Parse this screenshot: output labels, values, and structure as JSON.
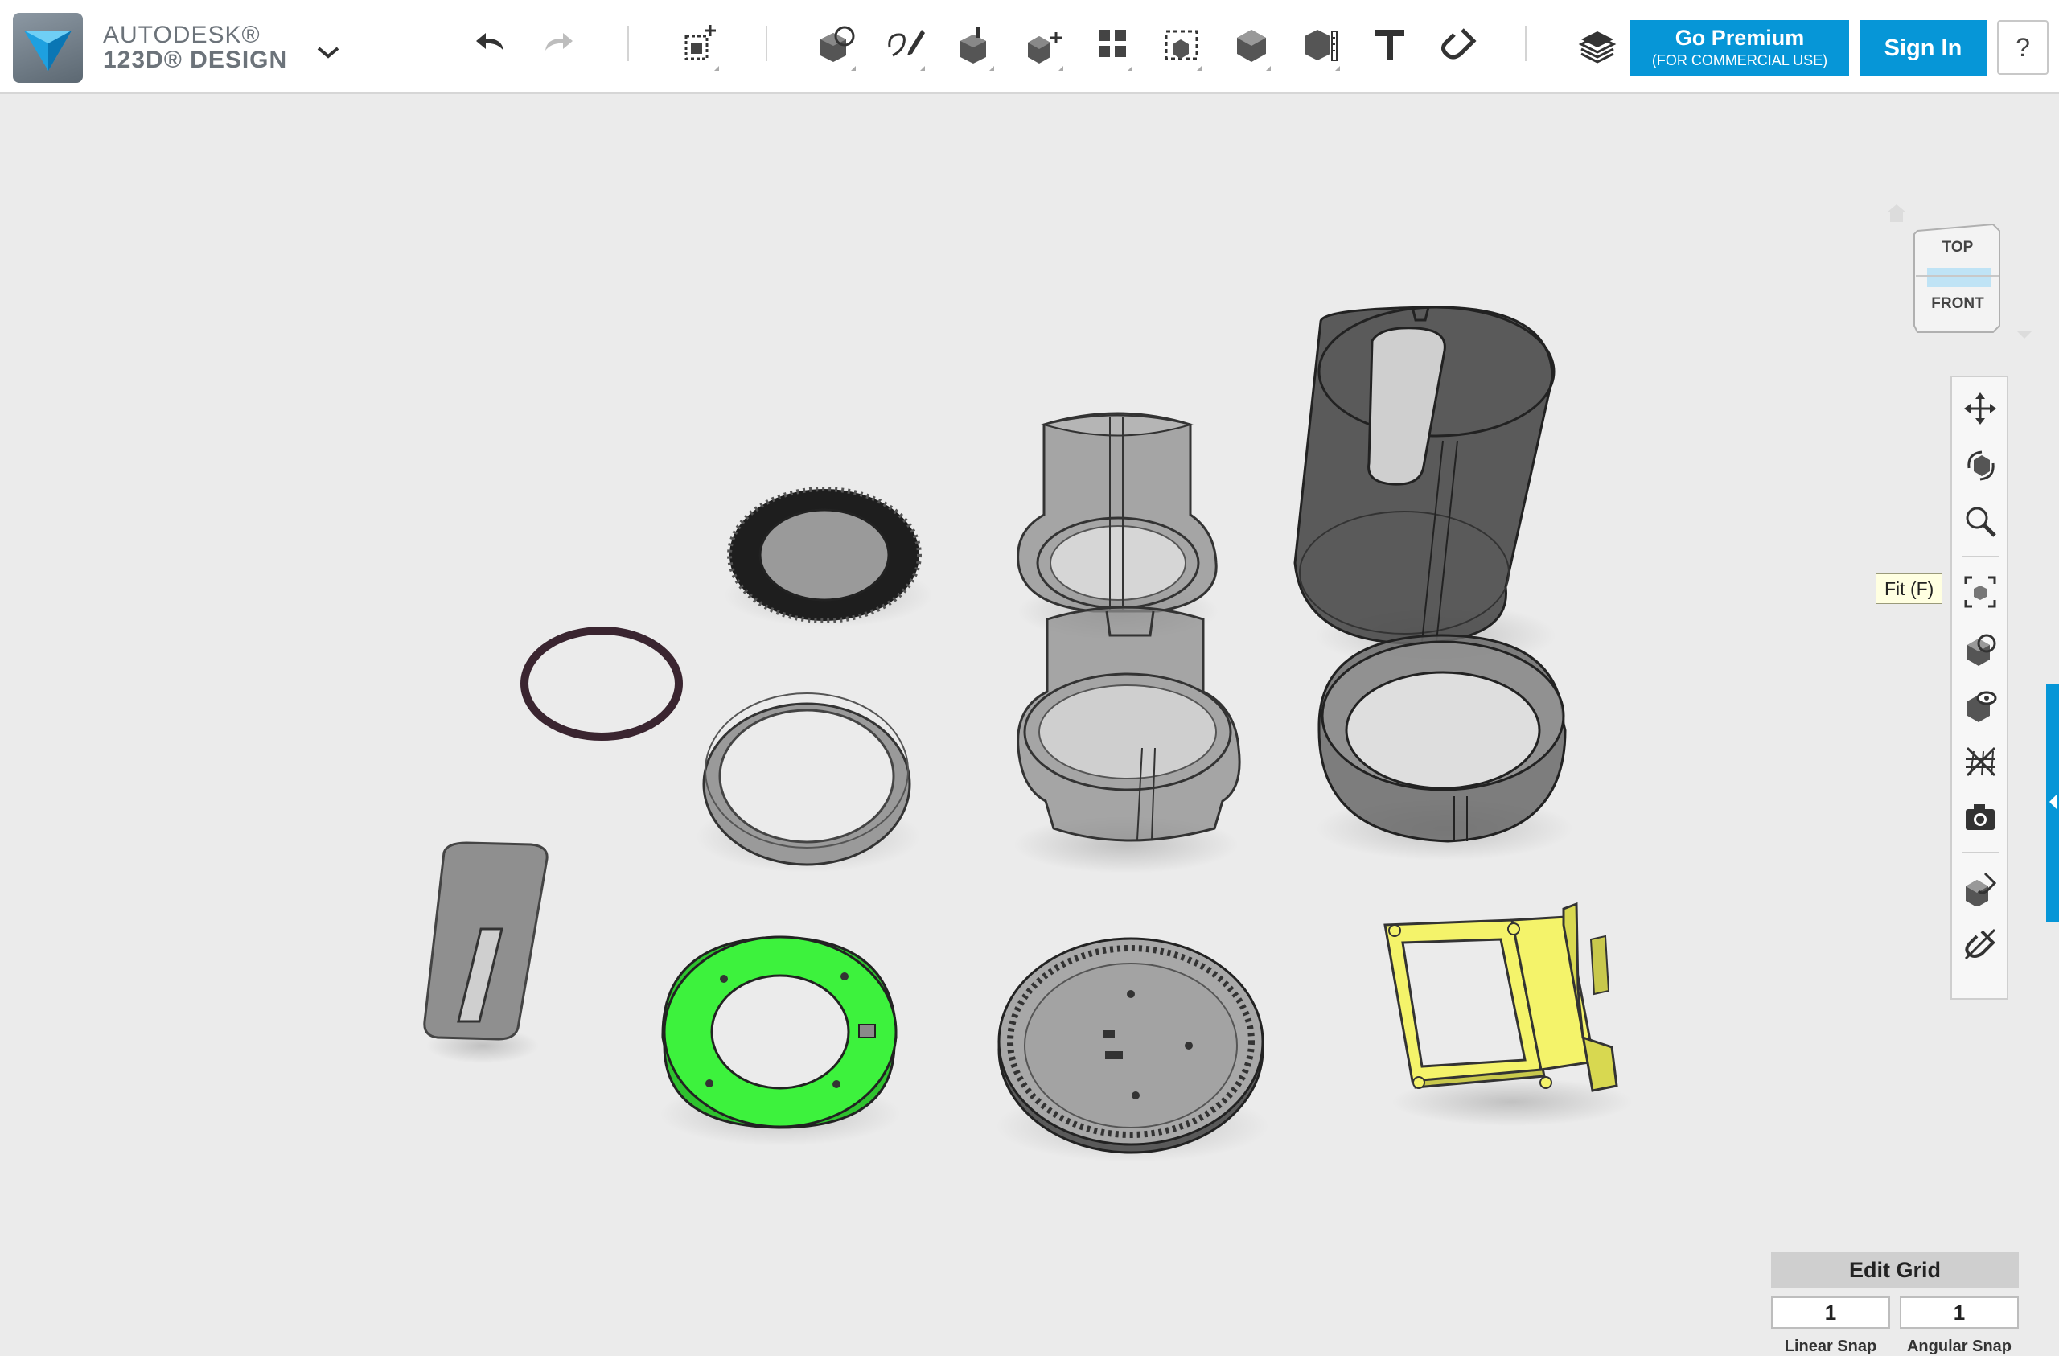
{
  "app": {
    "brand_top": "AUTODESK®",
    "brand_bottom": "123D® DESIGN",
    "accent_color": "#0696d7"
  },
  "toolbar": {
    "buttons": [
      {
        "icon": "undo-icon",
        "enabled": true
      },
      {
        "icon": "redo-icon",
        "enabled": false
      },
      {
        "icon": "transform-icon"
      },
      {
        "icon": "primitives-icon"
      },
      {
        "icon": "sketch-icon"
      },
      {
        "icon": "construct-icon"
      },
      {
        "icon": "modify-icon"
      },
      {
        "icon": "pattern-icon"
      },
      {
        "icon": "group-icon"
      },
      {
        "icon": "combine-icon"
      },
      {
        "icon": "measure-icon"
      },
      {
        "icon": "text-icon"
      },
      {
        "icon": "snap-icon"
      },
      {
        "icon": "materials-layers-icon"
      }
    ],
    "premium_line1": "Go Premium",
    "premium_line2": "(FOR COMMERCIAL USE)",
    "sign_in": "Sign In",
    "help": "?"
  },
  "viewcube": {
    "top": "TOP",
    "front": "FRONT"
  },
  "navbar": {
    "items": [
      {
        "icon": "pan-icon"
      },
      {
        "icon": "orbit-icon"
      },
      {
        "icon": "zoom-icon"
      },
      {
        "icon": "fit-icon"
      },
      {
        "icon": "view-mode-icon"
      },
      {
        "icon": "visibility-icon"
      },
      {
        "icon": "grid-toggle-icon"
      },
      {
        "icon": "camera-icon"
      },
      {
        "icon": "material-icon"
      },
      {
        "icon": "hide-snap-icon"
      }
    ],
    "tooltip": "Fit (F)"
  },
  "grid": {
    "title": "Edit Grid",
    "linear_value": "1",
    "angular_value": "1",
    "linear_label": "Linear Snap",
    "angular_label": "Angular Snap"
  },
  "scene": {
    "part_colors": {
      "green_ring": "#3df23d",
      "yellow_frame": "#f4f36a",
      "dark_ring": "#3a2530",
      "gray_parts": "#8a8a8a"
    }
  }
}
